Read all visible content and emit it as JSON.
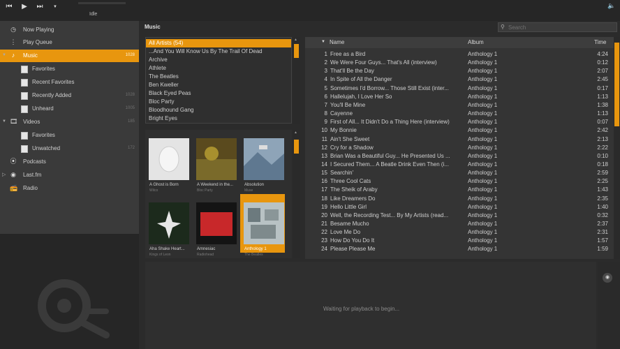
{
  "transport": {
    "prev_icon": "skip-back-icon",
    "play_icon": "play-icon",
    "next_icon": "skip-forward-icon",
    "dropdown_icon": "chevron-down-icon",
    "status": "Idle",
    "volume_icon": "speaker-icon"
  },
  "sidebar": {
    "now_playing": "Now Playing",
    "play_queue": "Play Queue",
    "music": {
      "label": "Music",
      "count": "1028"
    },
    "favorites": "Favorites",
    "recent_favorites": "Recent Favorites",
    "recently_added": {
      "label": "Recently Added",
      "count": "1028"
    },
    "unheard": {
      "label": "Unheard",
      "count": "1005"
    },
    "videos": {
      "label": "Videos",
      "count": "185"
    },
    "video_favorites": "Favorites",
    "unwatched": {
      "label": "Unwatched",
      "count": "172"
    },
    "podcasts": "Podcasts",
    "lastfm": "Last.fm",
    "radio": "Radio"
  },
  "main": {
    "title": "Music",
    "search_placeholder": "Search"
  },
  "artists": [
    "All Artists (54)",
    "...And You Will Know Us By The Trail Of Dead",
    "Archive",
    "Athlete",
    "The Beatles",
    "Ben Kweller",
    "Black Eyed Peas",
    "Bloc Party",
    "Bloodhound Gang",
    "Bright Eyes"
  ],
  "albums": [
    {
      "title": "A Ghost is Born",
      "artist": "Wilco"
    },
    {
      "title": "A Weekend in the...",
      "artist": "Bloc Party"
    },
    {
      "title": "Absolution",
      "artist": "Muse"
    },
    {
      "title": "Aha Shake Heart...",
      "artist": "Kings of Leon"
    },
    {
      "title": "Amnesiac",
      "artist": "Radiohead"
    },
    {
      "title": "Anthology 1",
      "artist": "The Beatles"
    }
  ],
  "tracks": {
    "headers": {
      "name": "Name",
      "album": "Album",
      "time": "Time"
    },
    "rows": [
      {
        "n": "1",
        "name": "Free as a Bird",
        "album": "Anthology 1",
        "time": "4:24"
      },
      {
        "n": "2",
        "name": "We Were Four Guys... That's All (interview)",
        "album": "Anthology 1",
        "time": "0:12"
      },
      {
        "n": "3",
        "name": "That'll Be the Day",
        "album": "Anthology 1",
        "time": "2:07"
      },
      {
        "n": "4",
        "name": "In Spite of All the Danger",
        "album": "Anthology 1",
        "time": "2:45"
      },
      {
        "n": "5",
        "name": "Sometimes I'd Borrow... Those Still Exist (inter...",
        "album": "Anthology 1",
        "time": "0:17"
      },
      {
        "n": "6",
        "name": "Hallelujah, I Love Her So",
        "album": "Anthology 1",
        "time": "1:13"
      },
      {
        "n": "7",
        "name": "You'll Be Mine",
        "album": "Anthology 1",
        "time": "1:38"
      },
      {
        "n": "8",
        "name": "Cayenne",
        "album": "Anthology 1",
        "time": "1:13"
      },
      {
        "n": "9",
        "name": "First of All... It Didn't Do a Thing Here (interview)",
        "album": "Anthology 1",
        "time": "0:07"
      },
      {
        "n": "10",
        "name": "My Bonnie",
        "album": "Anthology 1",
        "time": "2:42"
      },
      {
        "n": "11",
        "name": "Ain't She Sweet",
        "album": "Anthology 1",
        "time": "2:13"
      },
      {
        "n": "12",
        "name": "Cry for a Shadow",
        "album": "Anthology 1",
        "time": "2:22"
      },
      {
        "n": "13",
        "name": "Brian Was a Beautiful Guy... He Presented Us ...",
        "album": "Anthology 1",
        "time": "0:10"
      },
      {
        "n": "14",
        "name": "I Secured Them... A Beatle Drink Even Then (i...",
        "album": "Anthology 1",
        "time": "0:18"
      },
      {
        "n": "15",
        "name": "Searchin'",
        "album": "Anthology 1",
        "time": "2:59"
      },
      {
        "n": "16",
        "name": "Three Cool Cats",
        "album": "Anthology 1",
        "time": "2:25"
      },
      {
        "n": "17",
        "name": "The Sheik of Araby",
        "album": "Anthology 1",
        "time": "1:43"
      },
      {
        "n": "18",
        "name": "Like Dreamers Do",
        "album": "Anthology 1",
        "time": "2:35"
      },
      {
        "n": "19",
        "name": "Hello Little Girl",
        "album": "Anthology 1",
        "time": "1:40"
      },
      {
        "n": "20",
        "name": "Well, the Recording Test... By My Artists (read...",
        "album": "Anthology 1",
        "time": "0:32"
      },
      {
        "n": "21",
        "name": "Besame Mucho",
        "album": "Anthology 1",
        "time": "2:37"
      },
      {
        "n": "22",
        "name": "Love Me Do",
        "album": "Anthology 1",
        "time": "2:31"
      },
      {
        "n": "23",
        "name": "How Do You Do It",
        "album": "Anthology 1",
        "time": "1:57"
      },
      {
        "n": "24",
        "name": "Please Please Me",
        "album": "Anthology 1",
        "time": "1:59"
      }
    ]
  },
  "playback": {
    "message": "Waiting for playback to begin...",
    "mini_icon": "lastfm-icon"
  },
  "colors": {
    "accent": "#e8960e",
    "background": "#2b2b2b",
    "sidebar": "#3a3a3a"
  }
}
